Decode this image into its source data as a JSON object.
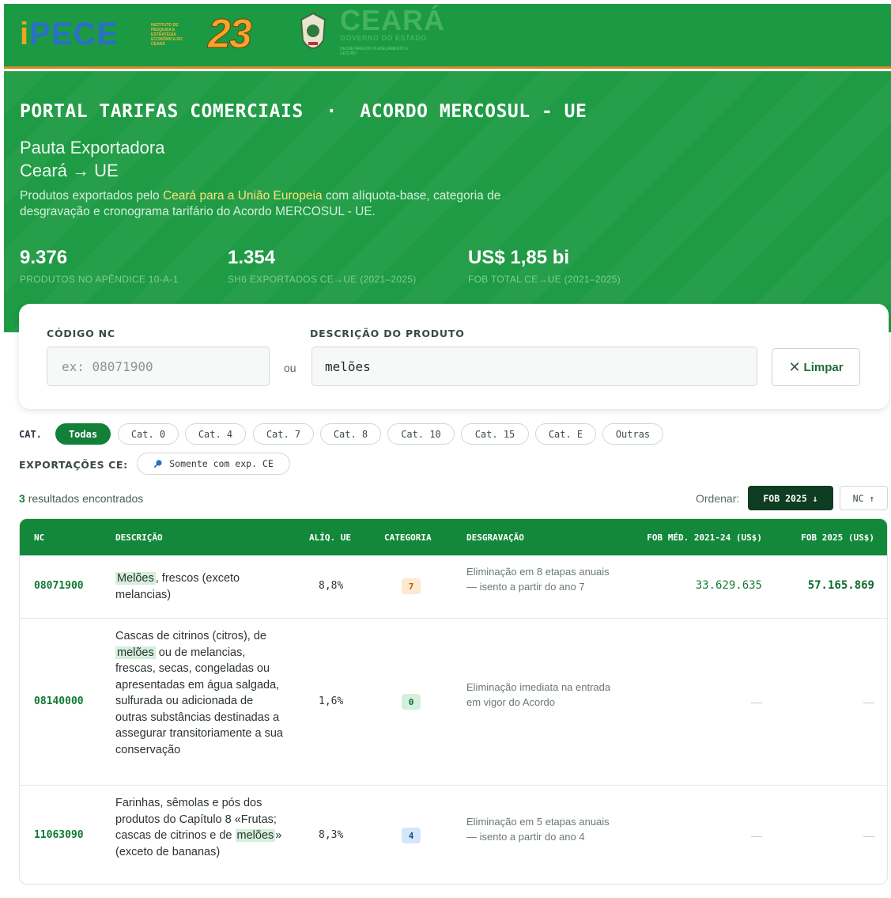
{
  "logos": {
    "ipece": "iPECE",
    "ipece_subtitle": "INSTITUTO DE PESQUISA E ESTRATÉGIA ECONÔMICA DO CEARÁ",
    "anniversary": "23",
    "ceara": "CEARÁ",
    "ceara_gov": "GOVERNO DO ESTADO",
    "ceara_secretaria": "SECRETARIA DO PLANEJAMENTO E GESTÃO"
  },
  "hero": {
    "title": "PORTAL TARIFAS COMERCIAIS  ·  ACORDO MERCOSUL - UE",
    "subtitle_1": "Pauta Exportadora",
    "subtitle_2": "Ceará → UE",
    "desc_pre": "Produtos exportados pelo ",
    "desc_highlight": "Ceará para a União Europeia",
    "desc_post": " com alíquota-base, categoria de desgravação e cronograma tarifário do Acordo MERCOSUL - UE.",
    "stats": [
      {
        "value": "9.376",
        "label": "PRODUTOS NO APÊNDICE 10-A-1"
      },
      {
        "value": "1.354",
        "label": "SH6 EXPORTADOS CE→UE (2021–2025)"
      },
      {
        "value": "US$ 1,85 bi",
        "label": "FOB TOTAL CE→UE (2021–2025)"
      }
    ]
  },
  "search": {
    "nc_label": "CÓDIGO NC",
    "nc_placeholder": "ex: 08071900",
    "nc_value": "",
    "or_text": "ou",
    "desc_label": "DESCRIÇÃO DO PRODUTO",
    "desc_value": "melões",
    "clear_label": "Limpar"
  },
  "filters": {
    "cat_label": "CAT.",
    "categories": [
      "Todas",
      "Cat. 0",
      "Cat. 4",
      "Cat. 7",
      "Cat. 8",
      "Cat. 10",
      "Cat. 15",
      "Cat. E",
      "Outras"
    ],
    "active_category": "Todas",
    "exports_label": "EXPORTAÇÕES CE:",
    "exports_toggle": "Somente com exp. CE"
  },
  "results": {
    "count": "3",
    "count_suffix": "resultados encontrados",
    "order_label": "Ordenar:",
    "sort_active": "FOB 2025 ↓",
    "sort_other": "NC ↑"
  },
  "table": {
    "headers": [
      "NC",
      "DESCRIÇÃO",
      "ALÍQ. UE",
      "CATEGORIA",
      "DESGRAVAÇÃO",
      "FOB MÉD. 2021-24 (US$)",
      "FOB 2025 (US$)"
    ],
    "rows": [
      {
        "nc": "08071900",
        "desc_pre": "",
        "desc_mark": "Melões",
        "desc_post": ", frescos (exceto melancias)",
        "aliq": "8,8%",
        "category": "7",
        "category_bg": "#fde9cf",
        "category_fg": "#b06000",
        "desg": "Eliminação em 8 etapas anuais — isento a partir do ano 7",
        "fob_med": "33.629.635",
        "fob_2025": "57.165.869"
      },
      {
        "nc": "08140000",
        "desc_pre": "Cascas de citrinos (citros), de ",
        "desc_mark": "melões",
        "desc_post": " ou de melancias, frescas, secas, congeladas ou apresentadas em água salgada, sulfurada ou adicionada de outras substâncias destinadas a assegurar transitoriamente a sua conservação",
        "aliq": "1,6%",
        "category": "0",
        "category_bg": "#d4f0dc",
        "category_fg": "#0d6a2e",
        "desg": "Eliminação imediata na entrada em vigor do Acordo",
        "fob_med": "—",
        "fob_2025": "—"
      },
      {
        "nc": "11063090",
        "desc_pre": "Farinhas, sêmolas e pós dos produtos do Capítulo 8 «Frutas; cascas de citrinos e de ",
        "desc_mark": "melões",
        "desc_post": "» (exceto de bananas)",
        "aliq": "8,3%",
        "category": "4",
        "category_bg": "#d6e6fa",
        "category_fg": "#1d4f9a",
        "desg": "Eliminação em 5 etapas anuais — isento a partir do ano 4",
        "fob_med": "—",
        "fob_2025": "—"
      }
    ]
  }
}
